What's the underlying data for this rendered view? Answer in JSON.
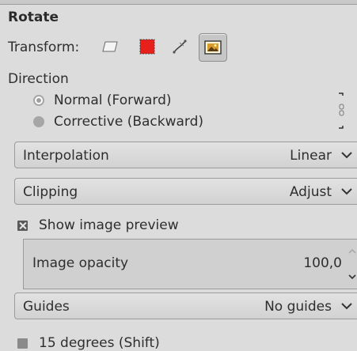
{
  "tool": {
    "title": "Rotate",
    "transform_label": "Transform:",
    "transform_icons": [
      "layer-transform-icon",
      "selection-transform-icon",
      "path-transform-icon",
      "image-transform-icon"
    ],
    "active_transform_index": 3,
    "direction_label": "Direction",
    "direction_options": [
      "Normal (Forward)",
      "Corrective (Backward)"
    ],
    "selected_direction": "Normal (Forward)"
  },
  "interpolation": {
    "label": "Interpolation",
    "value": "Linear"
  },
  "clipping": {
    "label": "Clipping",
    "value": "Adjust"
  },
  "preview": {
    "label": "Show image preview",
    "checked": true
  },
  "opacity": {
    "label": "Image opacity",
    "value": "100,0"
  },
  "guides": {
    "label": "Guides",
    "value": "No guides"
  },
  "constrain": {
    "label": "15 degrees (Shift)",
    "checked": false
  },
  "colors": {
    "background": "#dcdcdc",
    "layer_red": "#e8201c"
  }
}
